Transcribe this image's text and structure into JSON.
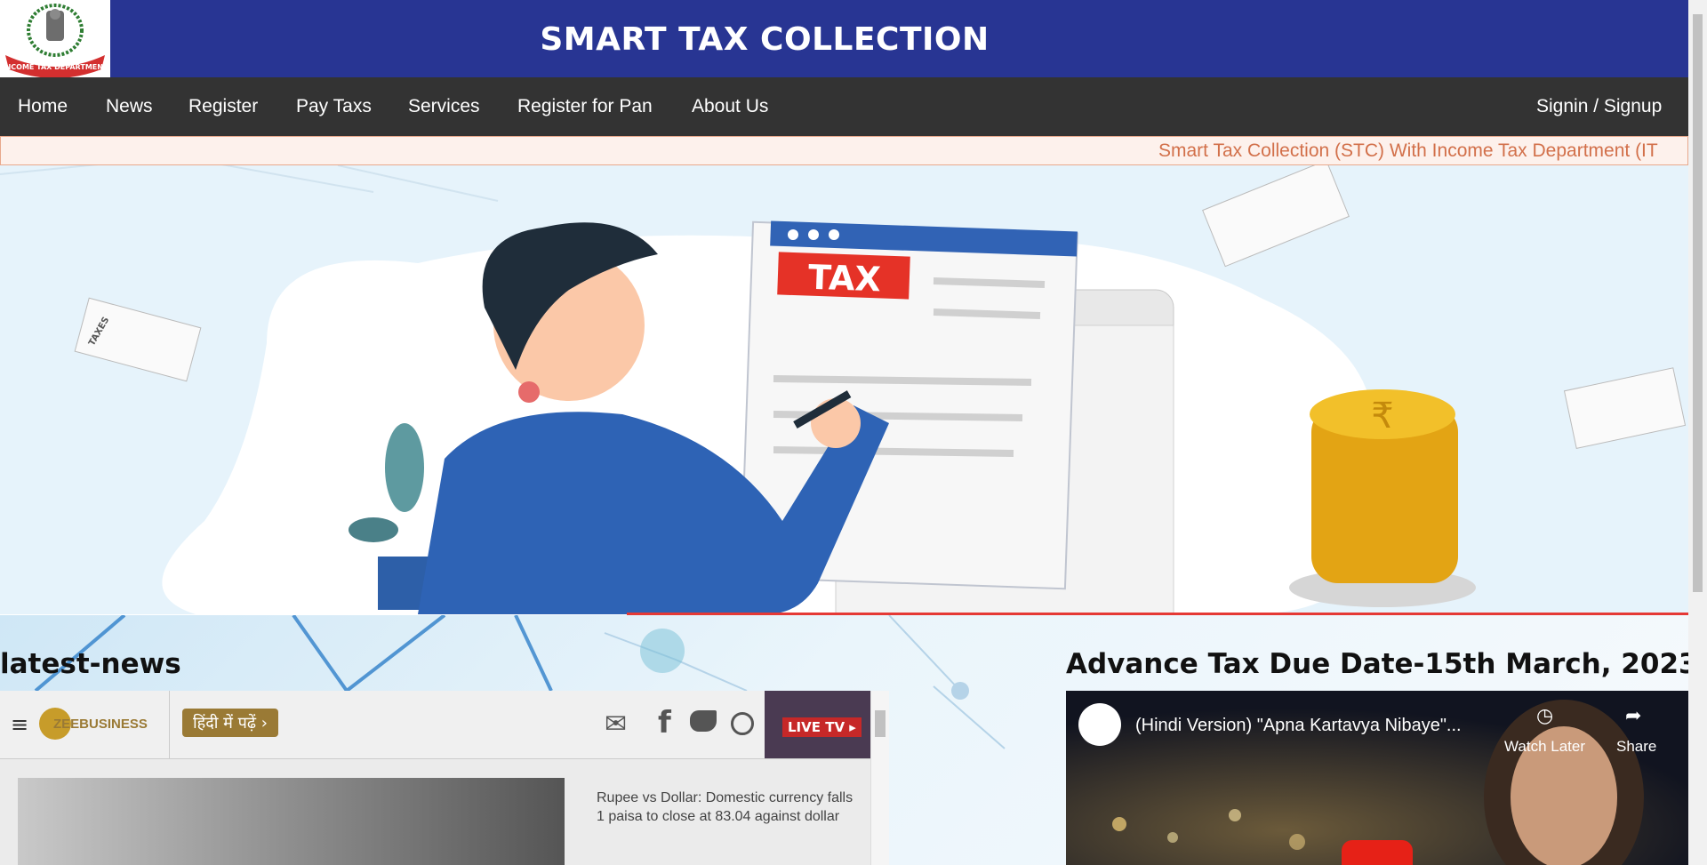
{
  "header": {
    "title": "SMART TAX COLLECTION",
    "logo_text": "INCOME TAX DEPARTMENT"
  },
  "nav": {
    "items": [
      "Home",
      "News",
      "Register",
      "Pay Taxs",
      "Services",
      "Register for Pan",
      "About Us"
    ],
    "signin": "Signin / Signup"
  },
  "ticker": {
    "text": "Smart Tax Collection (STC) With Income Tax Department (IT"
  },
  "hero": {
    "tax_label": "TAX",
    "paper_label": "TAXES"
  },
  "latest_news": {
    "heading": "latest-news",
    "brand": "ZEEBUSINESS",
    "hindi_button": "हिंदी में पढ़ें ›",
    "live_tv": "LIVE TV ▸",
    "headline": "Rupee vs Dollar: Domestic currency falls 1 paisa to close at 83.04 against dollar"
  },
  "video_section": {
    "heading": "Advance Tax Due Date-15th March, 2023",
    "video_title": "(Hindi Version) \"Apna Kartavya Nibaye\"...",
    "watch_later": "Watch Later",
    "share": "Share"
  },
  "colors": {
    "header_bg": "#283593",
    "nav_bg": "#333333",
    "ticker_text": "#d2704a",
    "tax_red": "#e53227"
  }
}
